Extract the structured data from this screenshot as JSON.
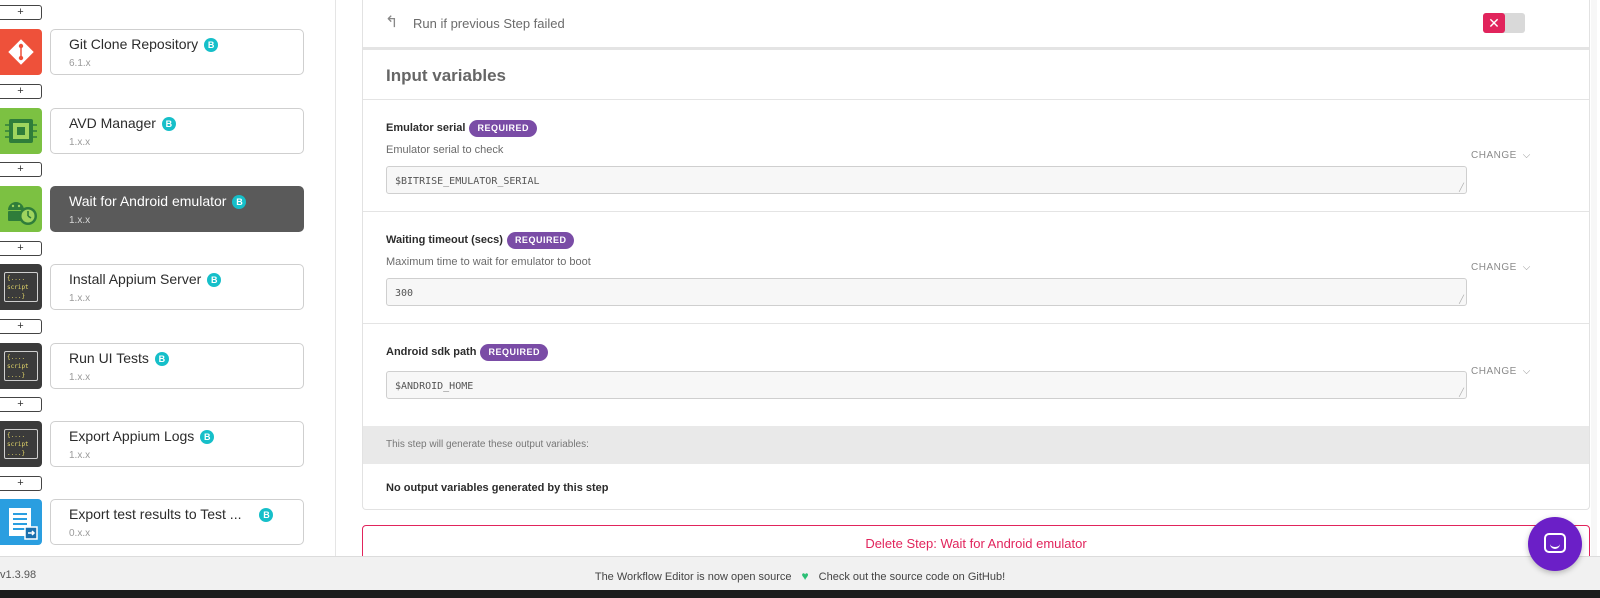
{
  "steps": [
    {
      "title": "Git Clone Repository",
      "version": "6.1.x",
      "badge": "B",
      "icon": "git-icon"
    },
    {
      "title": "AVD Manager",
      "version": "1.x.x",
      "badge": "B",
      "icon": "android-chip-icon"
    },
    {
      "title": "Wait for Android emulator",
      "version": "1.x.x",
      "badge": "B",
      "icon": "android-clock-icon",
      "selected": true
    },
    {
      "title": "Install Appium Server",
      "version": "1.x.x",
      "badge": "B",
      "icon": "script-icon"
    },
    {
      "title": "Run UI Tests",
      "version": "1.x.x",
      "badge": "B",
      "icon": "script-icon"
    },
    {
      "title": "Export Appium Logs",
      "version": "1.x.x",
      "badge": "B",
      "icon": "script-icon"
    },
    {
      "title": "Export test results to Test ...",
      "version": "0.x.x",
      "badge": "B",
      "icon": "list-export-icon"
    }
  ],
  "add_label": "+",
  "script_text": "{....\nscript\n....}",
  "run_if_failed": {
    "label": "Run if previous Step failed",
    "toggle": "✕"
  },
  "input_variables": {
    "title": "Input variables",
    "required_label": "REQUIRED",
    "change_label": "CHANGE",
    "vars": [
      {
        "title": "Emulator serial",
        "description": "Emulator serial to check",
        "value": "$BITRISE_EMULATOR_SERIAL"
      },
      {
        "title": "Waiting timeout (secs)",
        "description": "Maximum time to wait for emulator to boot",
        "value": "300"
      },
      {
        "title": "Android sdk path",
        "description": "",
        "value": "$ANDROID_HOME"
      }
    ]
  },
  "output": {
    "label": "This step will generate these output variables:",
    "none": "No output variables generated by this step"
  },
  "delete_step": "Delete Step: Wait for Android emulator",
  "footer": {
    "version": "v1.3.98",
    "text_left": "The Workflow Editor is now open source",
    "text_right": "Check out the source code on GitHub!"
  },
  "colors": {
    "accent": "#7a4ca6",
    "danger": "#e1245c",
    "badge": "#16bfc9",
    "chat": "#6b1fc7"
  }
}
